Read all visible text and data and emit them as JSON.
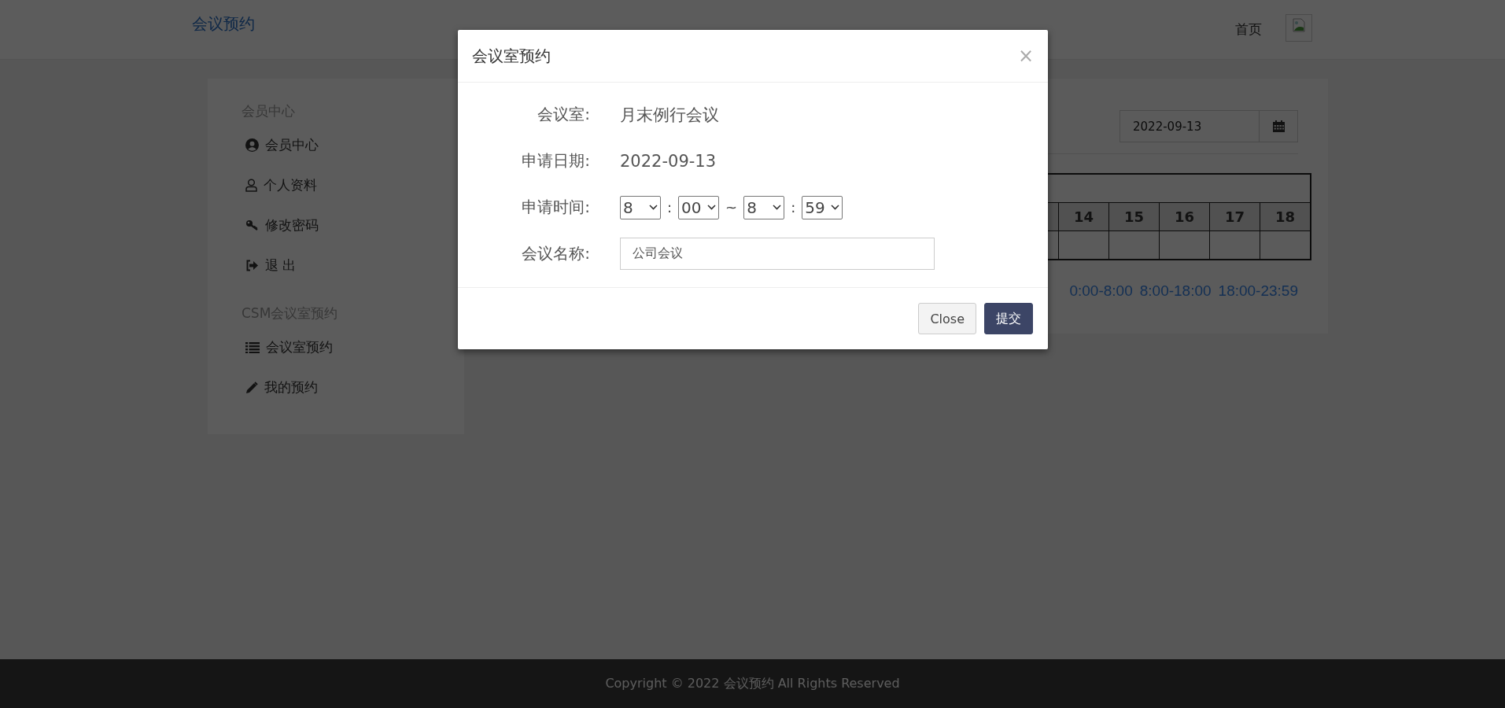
{
  "header": {
    "brand": "会议预约",
    "nav_link": "首页"
  },
  "sidebar": {
    "sections": [
      {
        "title": "会员中心",
        "items": [
          {
            "kind": "user-circle",
            "label": "会员中心"
          },
          {
            "kind": "user",
            "label": "个人资料"
          },
          {
            "kind": "key",
            "label": "修改密码"
          },
          {
            "kind": "sign-out",
            "label": "退 出"
          }
        ]
      },
      {
        "title": "CSM会议室预约",
        "items": [
          {
            "kind": "list",
            "label": "会议室预约"
          },
          {
            "kind": "pencil",
            "label": "我的预约"
          }
        ]
      }
    ]
  },
  "main": {
    "date_picker": {
      "value": "2022-09-13"
    },
    "schedule": {
      "hours": [
        "14",
        "15",
        "16",
        "17",
        "18"
      ]
    },
    "time_ranges": [
      "0:00-8:00",
      "8:00-18:00",
      "18:00-23:59"
    ]
  },
  "modal": {
    "title": "会议室预约",
    "close": "×",
    "fields": [
      {
        "kind": "text",
        "label": "会议室:",
        "value": "月末例行会议"
      },
      {
        "kind": "text",
        "label": "申请日期:",
        "value": "2022-09-13"
      },
      {
        "kind": "time-range",
        "label": "申请时间:",
        "parts": [
          {
            "kind": "select",
            "value": "8"
          },
          {
            "kind": "sep",
            "value": ":"
          },
          {
            "kind": "select",
            "value": "00"
          },
          {
            "kind": "sep",
            "value": "~"
          },
          {
            "kind": "select",
            "value": "8"
          },
          {
            "kind": "sep",
            "value": ":"
          },
          {
            "kind": "select",
            "value": "59"
          }
        ]
      },
      {
        "kind": "input",
        "label": "会议名称:",
        "value": "公司会议"
      }
    ],
    "buttons": [
      {
        "kind": "default",
        "label": "Close"
      },
      {
        "kind": "primary",
        "label": "提交"
      }
    ]
  },
  "footer": {
    "copyright": "Copyright © 2022 会议预约 All Rights Reserved"
  }
}
